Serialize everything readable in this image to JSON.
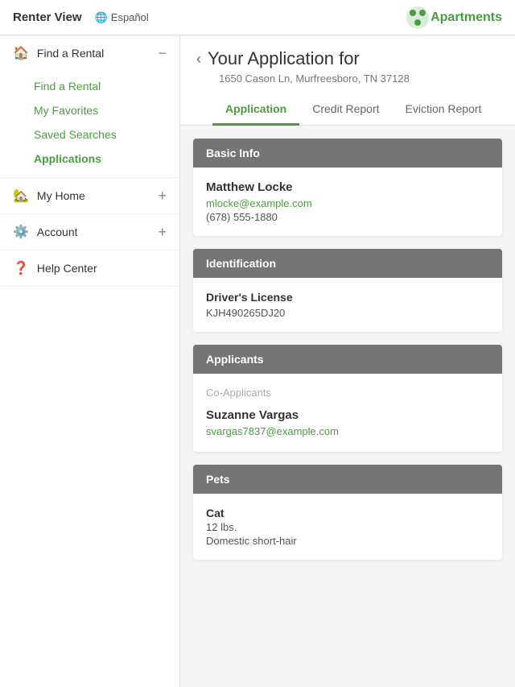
{
  "topNav": {
    "title": "Renter View",
    "lang": "Español",
    "logoText": "Apartments"
  },
  "sidebar": {
    "sections": [
      {
        "id": "find-a-rental",
        "icon": "🏠",
        "label": "Find a Rental",
        "toggle": "−",
        "children": [
          {
            "id": "find-a-rental-child",
            "label": "Find a Rental",
            "active": false,
            "green": true
          },
          {
            "id": "my-favorites",
            "label": "My Favorites",
            "active": false,
            "green": true
          },
          {
            "id": "saved-searches",
            "label": "Saved Searches",
            "active": false,
            "green": true
          },
          {
            "id": "applications",
            "label": "Applications",
            "active": true,
            "green": false
          }
        ]
      },
      {
        "id": "my-home",
        "icon": "🏡",
        "label": "My Home",
        "toggle": "+",
        "children": []
      },
      {
        "id": "account",
        "icon": "⚙️",
        "label": "Account",
        "toggle": "+",
        "children": []
      },
      {
        "id": "help-center",
        "icon": "❓",
        "label": "Help Center",
        "toggle": "",
        "children": []
      }
    ]
  },
  "content": {
    "backLabel": "Your Application for",
    "subtitle": "1650 Cason Ln, Murfreesboro, TN 37128",
    "tabs": [
      {
        "id": "application",
        "label": "Application",
        "active": true
      },
      {
        "id": "credit-report",
        "label": "Credit Report",
        "active": false
      },
      {
        "id": "eviction-report",
        "label": "Eviction Report",
        "active": false
      }
    ],
    "cards": [
      {
        "id": "basic-info",
        "header": "Basic Info",
        "type": "basic",
        "name": "Matthew Locke",
        "email": "mlocke@example.com",
        "phone": "(678) 555-1880"
      },
      {
        "id": "identification",
        "header": "Identification",
        "type": "id",
        "idType": "Driver's License",
        "idValue": "KJH490265DJ20"
      },
      {
        "id": "applicants",
        "header": "Applicants",
        "type": "applicants",
        "coApplicantsLabel": "Co-Applicants",
        "coApplicants": [
          {
            "name": "Suzanne Vargas",
            "email": "svargas7837@example.com"
          }
        ]
      },
      {
        "id": "pets",
        "header": "Pets",
        "type": "pets",
        "pets": [
          {
            "type": "Cat",
            "weight": "12 lbs.",
            "breed": "Domestic short-hair"
          }
        ]
      }
    ]
  }
}
